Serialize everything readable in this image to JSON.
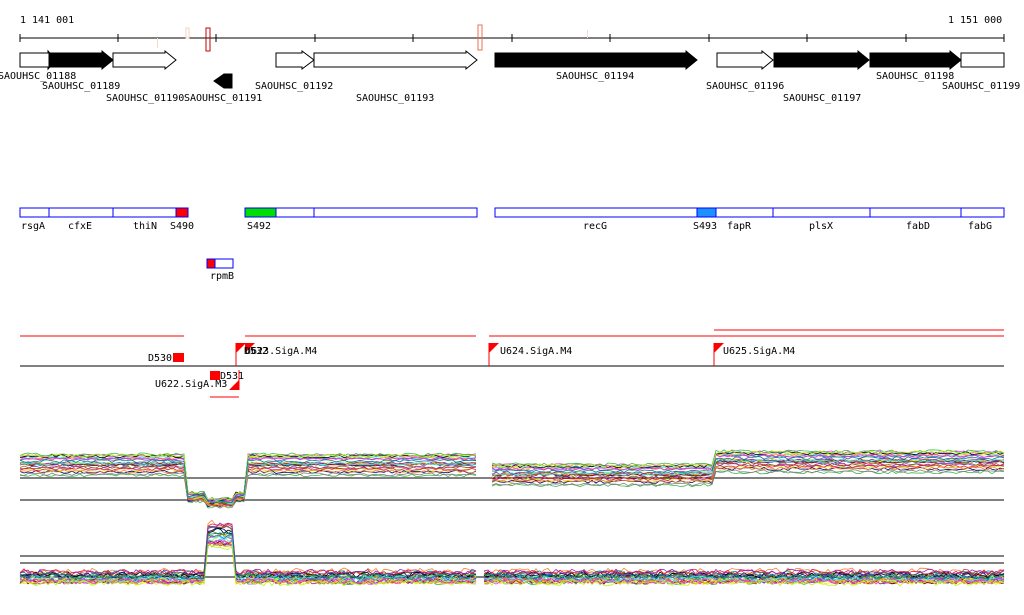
{
  "ruler": {
    "start": "1 141 001",
    "end": "1 151 000"
  },
  "genes": [
    "SAOUHSC_01188",
    "SAOUHSC_01189",
    "SAOUHSC_01190",
    "SAOUHSC_01191",
    "SAOUHSC_01192",
    "SAOUHSC_01193",
    "SAOUHSC_01194",
    "SAOUHSC_01196",
    "SAOUHSC_01197",
    "SAOUHSC_01198",
    "SAOUHSC_01199"
  ],
  "operon_genes": [
    "rsgA",
    "cfxE",
    "thiN",
    "S490",
    "S492",
    "recG",
    "S493",
    "fapR",
    "plsX",
    "fabD",
    "fabG",
    "rpmB"
  ],
  "features": [
    "D530",
    "D531",
    "U622.SigA.M3",
    "U623.SigA.M4",
    "U624.SigA.M4",
    "U625.SigA.M4",
    "D532"
  ],
  "colors": {
    "accent": "#ff0000",
    "green": "#00dd00",
    "blue": "#0000ff",
    "skyblue": "#1e90ff"
  }
}
